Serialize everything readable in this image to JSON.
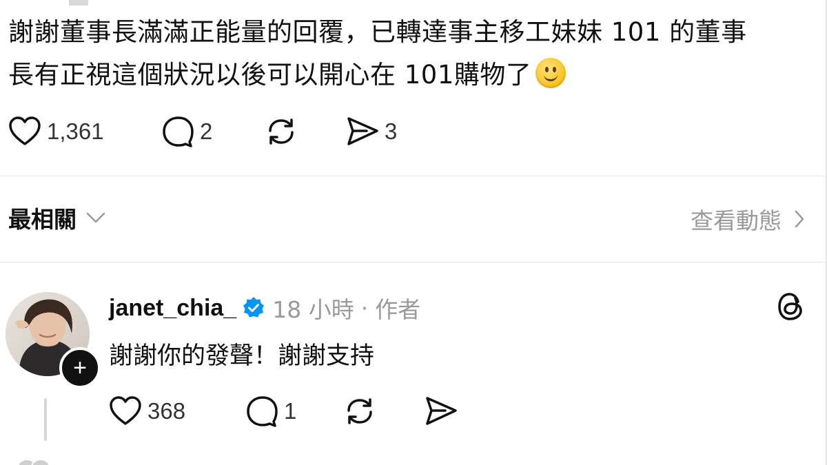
{
  "post": {
    "text_line_1": "謝謝董事長滿滿正能量的回覆，已轉達事主移工妹妹 101 的董事",
    "text_line_2": "長有正視這個狀況以後可以開心在 101購物了",
    "emoji": "slightly-smiling-face-emoji",
    "likes": "1,361",
    "comments": "2",
    "shares": "3"
  },
  "sort": {
    "label": "最相關",
    "view_activity": "查看動態"
  },
  "reply": {
    "username": "janet_chia_",
    "time": "18 小時",
    "separator": "·",
    "author_label": "作者",
    "text": "謝謝你的發聲！謝謝支持",
    "likes": "368",
    "comments": "1",
    "follow_symbol": "+"
  },
  "icons": {
    "like": "heart-icon",
    "comment": "comment-bubble-icon",
    "repost": "repost-icon",
    "share": "send-icon",
    "verified": "verified-badge-icon",
    "threads": "threads-logo-icon",
    "dropdown": "chevron-down-icon",
    "more": "chevron-right-icon"
  },
  "colors": {
    "text_primary": "#111111",
    "text_secondary": "#9a9a9a",
    "verified_blue": "#0095f6",
    "divider": "#e6e6e6"
  }
}
